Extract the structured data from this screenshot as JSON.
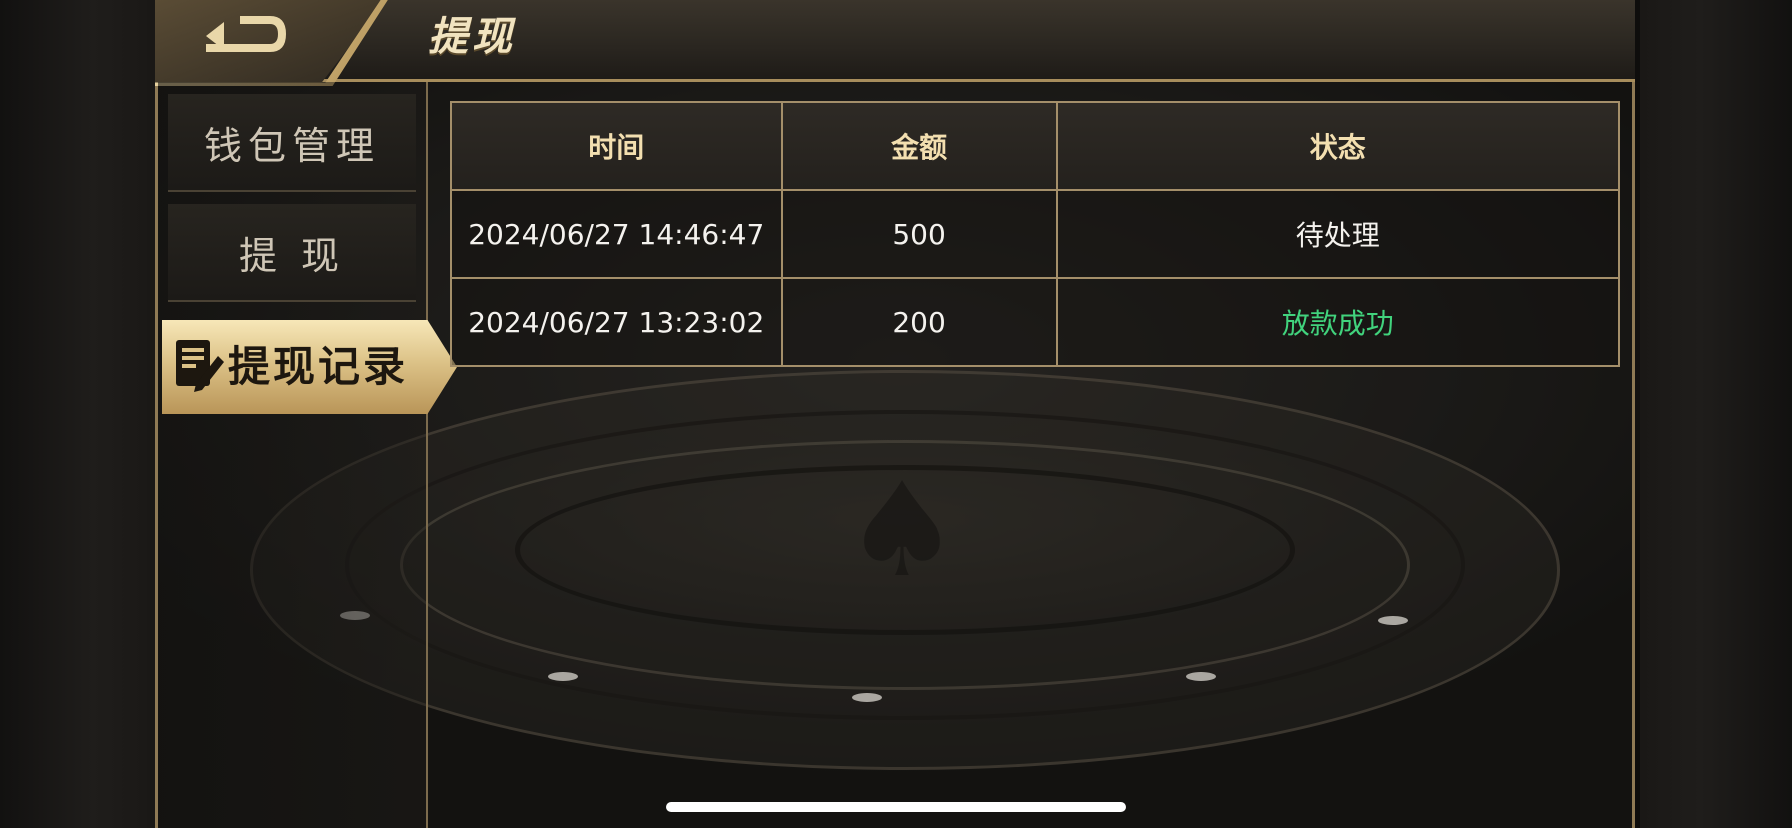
{
  "header": {
    "title": "提现",
    "back_icon": "back-arrow-icon"
  },
  "sidebar": {
    "items": [
      {
        "label": "钱包管理"
      },
      {
        "label": "提 现"
      },
      {
        "label": "提现记录",
        "icon": "edit-document-icon",
        "active": true
      }
    ]
  },
  "table": {
    "headers": [
      "时间",
      "金额",
      "状态"
    ],
    "rows": [
      {
        "time": "2024/06/27 14:46:47",
        "amount": "500",
        "status": "待处理"
      },
      {
        "time": "2024/06/27 13:23:02",
        "amount": "200",
        "status": "放款成功"
      }
    ]
  },
  "colors": {
    "gold": "#f3dfb0",
    "success": "#41d37d",
    "border": "#a48f6a"
  }
}
